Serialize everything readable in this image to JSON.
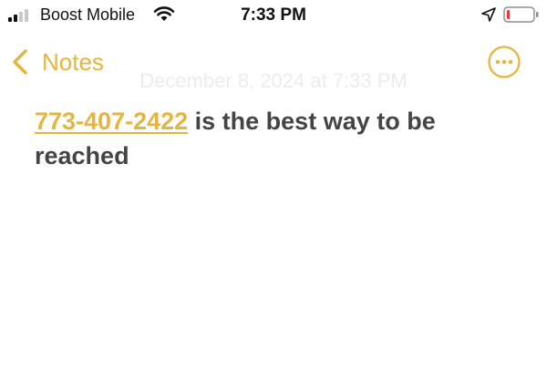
{
  "status": {
    "carrier": "Boost Mobile",
    "time": "7:33 PM"
  },
  "nav": {
    "back_label": "Notes",
    "date_ghost": "December 8, 2024 at 7:33 PM"
  },
  "note": {
    "phone": "773-407-2422",
    "text": " is the best way to be reached"
  },
  "colors": {
    "accent": "#e6b53e",
    "text": "#444444",
    "battery_low": "#e33b3b"
  },
  "icons": [
    "signal-icon",
    "wifi-icon",
    "location-arrow-icon",
    "battery-icon",
    "chevron-left-icon",
    "more-icon"
  ]
}
